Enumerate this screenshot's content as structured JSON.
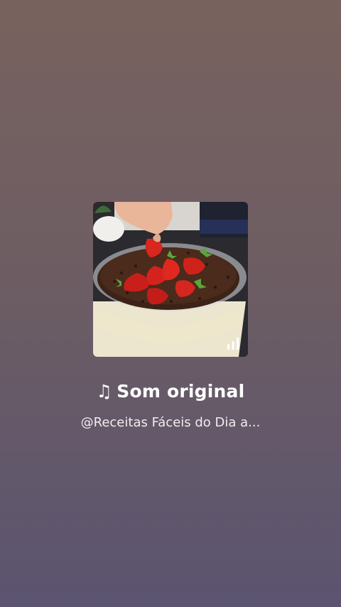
{
  "audio": {
    "note_glyph": "♫",
    "title": "Som original",
    "author": "@Receitas Fáceis do Dia a..."
  },
  "cover": {
    "indicator_icon": "audio-bars-icon"
  }
}
